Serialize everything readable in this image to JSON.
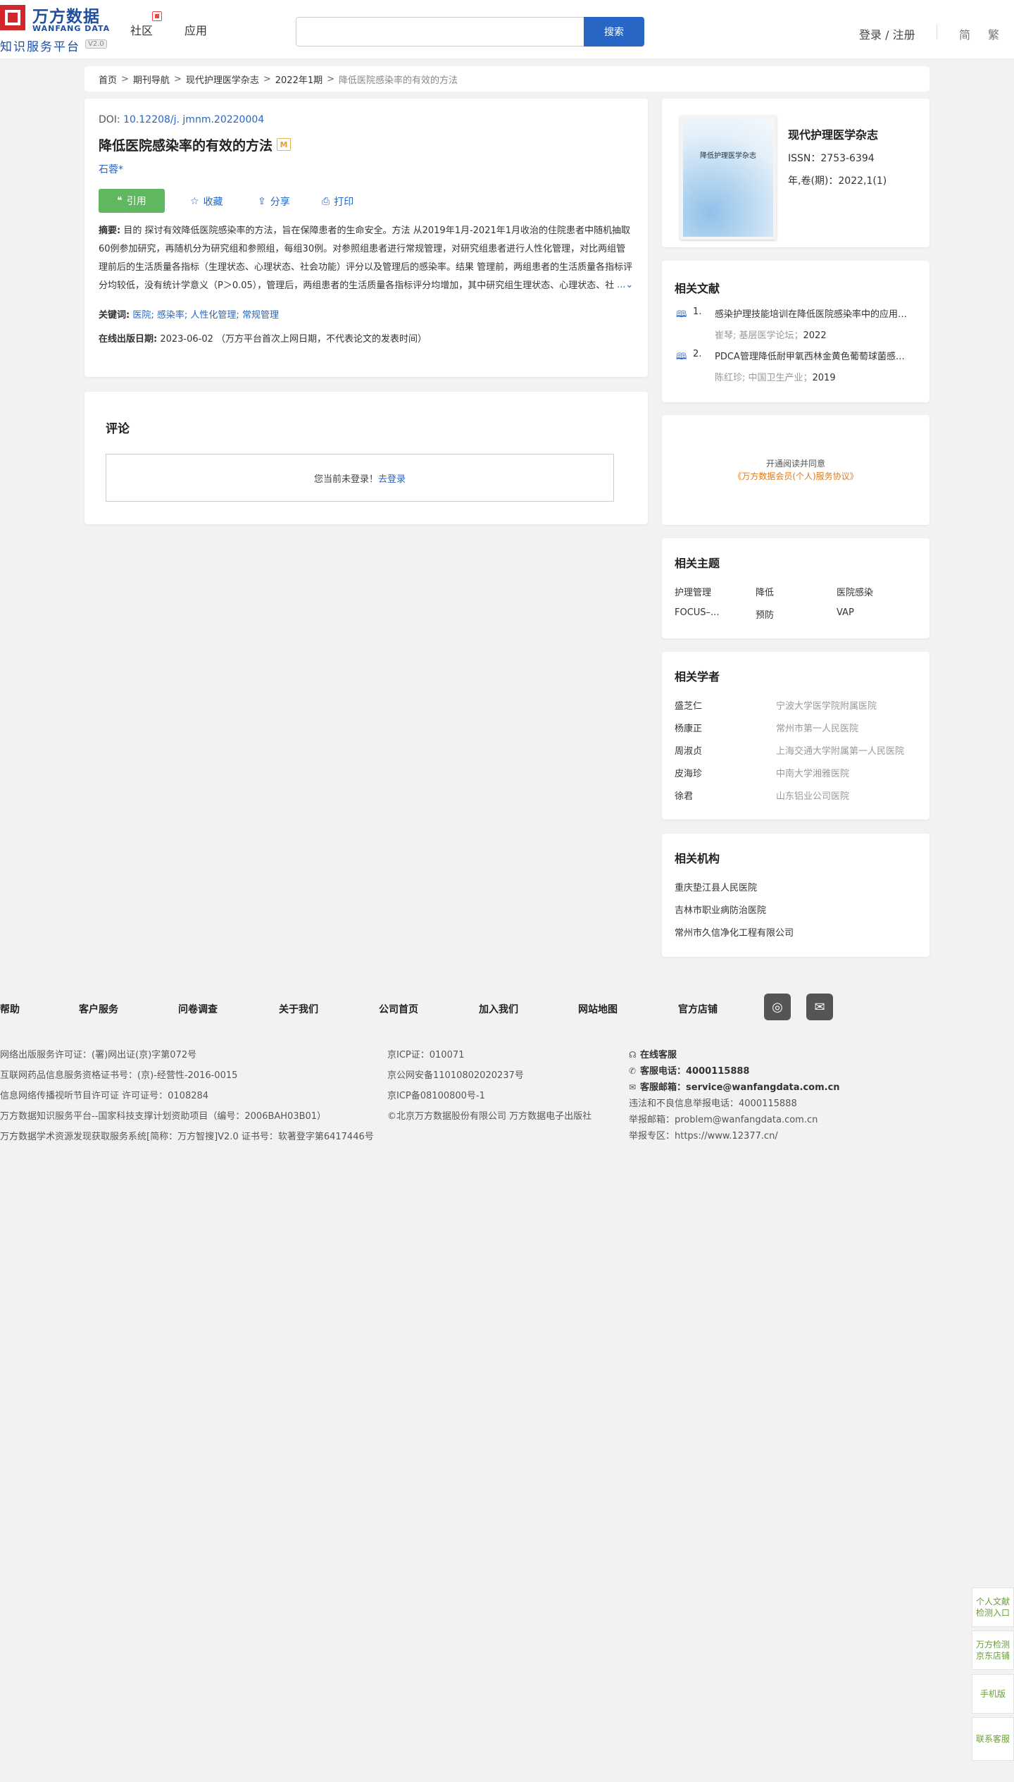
{
  "header": {
    "logo_cn": "万方数据",
    "logo_en": "WANFANG DATA",
    "logo_sub": "知识服务平台",
    "logo_version": "V2.0",
    "nav": [
      "社区",
      "应用"
    ],
    "search_placeholder": "",
    "search_button": "搜索",
    "login": "登录 / 注册",
    "lang_simplified": "简",
    "lang_traditional": "繁"
  },
  "breadcrumb": {
    "items": [
      "首页",
      "期刊导航",
      "现代护理医学杂志",
      "2022年1期"
    ],
    "separator": ">",
    "current": "降低医院感染率的有效的方法"
  },
  "article": {
    "doi_label": "DOI:",
    "doi_value": "10.12208/j. jmnm.20220004",
    "title": "降低医院感染率的有效的方法",
    "title_badge": "M",
    "author": "石蓉*",
    "actions": {
      "cite": "引用",
      "favorite": "收藏",
      "share": "分享",
      "print": "打印"
    },
    "abstract_label": "摘要:",
    "abstract_text": "目的 探讨有效降低医院感染率的方法，旨在保障患者的生命安全。方法 从2019年1月-2021年1月收治的住院患者中随机抽取60例参加研究，再随机分为研究组和参照组，每组30例。对参照组患者进行常规管理，对研究组患者进行人性化管理，对比两组管理前后的生活质量各指标（生理状态、心理状态、社会功能）评分以及管理后的感染率。结果 管理前，两组患者的生活质量各指标评分均较低，没有统计学意义（P＞0.05），管理后，两组患者的生活质量各指标评分均增加，其中研究组生理状态、心理状态、社会功能评分高于参照组，有统计学意义（P＜0.05）；研究组的感染率低于参照组，",
    "abstract_more": "...",
    "keywords_label": "关键词:",
    "keywords": [
      "医院;",
      "感染率;",
      "人性化管理;",
      "常规管理"
    ],
    "pubdate_label": "在线出版日期:",
    "pubdate_value": "2023-06-02 （万方平台首次上网日期，不代表论文的发表时间）"
  },
  "comment": {
    "title": "评论",
    "prompt": "您当前未登录！",
    "login_link": "去登录"
  },
  "journal": {
    "cover_title": "降低护理医学杂志",
    "name": "现代护理医学杂志",
    "issn": "ISSN：2753-6394",
    "volume": "年,卷(期)：2022,1(1)"
  },
  "related_docs": {
    "title": "相关文献",
    "items": [
      {
        "num": "1.",
        "title": "感染护理技能培训在降低医院感染率中的应用研究",
        "authors": "崔琴; 基层医学论坛；",
        "year": "2022"
      },
      {
        "num": "2.",
        "title": "PDCA管理降低耐甲氧西林金黄色葡萄球菌感染率",
        "authors": "陈红珍; 中国卫生产业；",
        "year": "2019"
      }
    ]
  },
  "ad": {
    "line1": "开通阅读并同意",
    "line2": "《万方数据会员(个人)服务协议》"
  },
  "related_topics": {
    "title": "相关主题",
    "items": [
      "护理管理",
      "降低",
      "医院感染",
      "FOCUS–...",
      "预防",
      "VAP"
    ]
  },
  "related_scholars": {
    "title": "相关学者",
    "items": [
      {
        "name": "盛芝仁",
        "org": "宁波大学医学院附属医院"
      },
      {
        "name": "杨康正",
        "org": "常州市第一人民医院"
      },
      {
        "name": "周淑贞",
        "org": "上海交通大学附属第一人民医院"
      },
      {
        "name": "皮海珍",
        "org": "中南大学湘雅医院"
      },
      {
        "name": "徐君",
        "org": "山东铝业公司医院"
      }
    ]
  },
  "related_institutions": {
    "title": "相关机构",
    "items": [
      "重庆垫江县人民医院",
      "吉林市职业病防治医院",
      "常州市久信净化工程有限公司"
    ]
  },
  "footer": {
    "links": [
      "帮助",
      "客户服务",
      "问卷调查",
      "关于我们",
      "公司首页",
      "加入我们",
      "网站地图",
      "官方店铺"
    ],
    "col1": [
      "网络出版服务许可证：(署)网出证(京)字第072号",
      "互联网药品信息服务资格证书号：(京)-经营性-2016-0015",
      "信息网络传播视听节目许可证 许可证号：0108284",
      "万方数据知识服务平台--国家科技支撑计划资助项目（编号：2006BAH03B01）",
      "万方数据学术资源发现获取服务系统[简称：万方智搜]V2.0 证书号：软著登字第6417446号"
    ],
    "col2": [
      "京ICP证：010071",
      "京公网安备11010802020237号",
      "京ICP备08100800号-1",
      "©北京万方数据股份有限公司 万方数据电子出版社"
    ],
    "online_service": "在线客服",
    "phone_label": "客服电话：",
    "phone_value": "4000115888",
    "email_label": "客服邮箱：",
    "email_value": "service@wanfangdata.com.cn",
    "report_phone": "违法和不良信息举报电话：4000115888",
    "report_email": "举报邮箱：problem@wanfangdata.com.cn",
    "report_zone": "举报专区：https://www.12377.cn/"
  },
  "float_bar": {
    "items": [
      "个人文献检测入口",
      "万方检测京东店铺",
      "手机版",
      "联系客服"
    ]
  }
}
